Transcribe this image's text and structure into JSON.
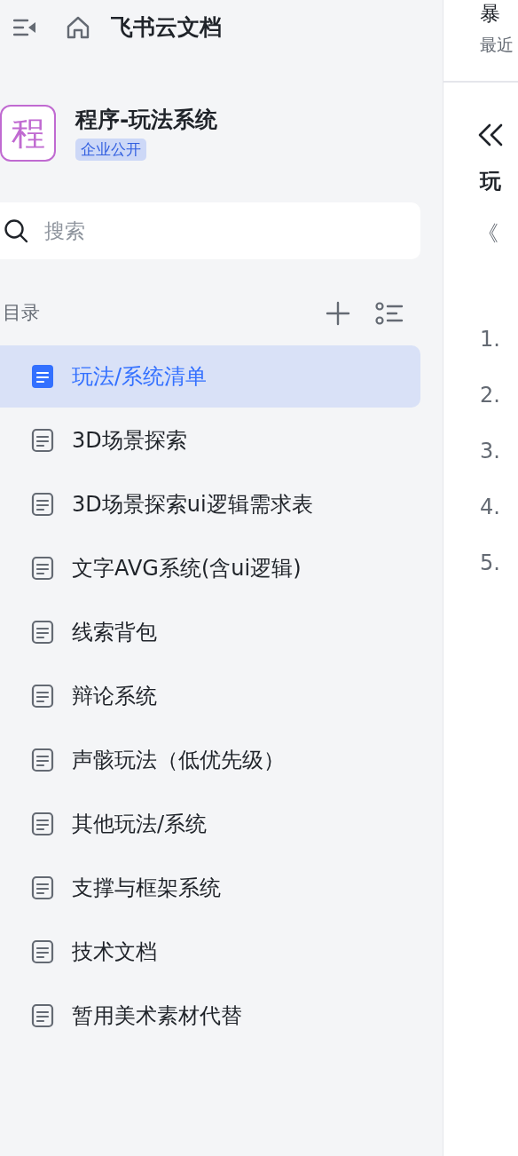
{
  "header": {
    "title": "飞书云文档"
  },
  "space": {
    "avatar": "程",
    "name": "程序-玩法系统",
    "badge": "企业公开"
  },
  "search": {
    "placeholder": "搜索"
  },
  "toc": {
    "label": "目录"
  },
  "items": [
    {
      "label": "玩法/系统清单",
      "selected": true
    },
    {
      "label": "3D场景探索",
      "selected": false
    },
    {
      "label": "3D场景探索ui逻辑需求表",
      "selected": false
    },
    {
      "label": "文字AVG系统(含ui逻辑)",
      "selected": false
    },
    {
      "label": "线索背包",
      "selected": false
    },
    {
      "label": "辩论系统",
      "selected": false
    },
    {
      "label": "声骸玩法（低优先级）",
      "selected": false
    },
    {
      "label": "其他玩法/系统",
      "selected": false
    },
    {
      "label": "支撑与框架系统",
      "selected": false
    },
    {
      "label": "技术文档",
      "selected": false
    },
    {
      "label": "暂用美术素材代替",
      "selected": false
    }
  ],
  "content": {
    "doc_title": "暴",
    "recent": "最近",
    "heading": "玩",
    "quote": "《",
    "list": [
      "1.",
      "2.",
      "3.",
      "4.",
      "5."
    ]
  }
}
